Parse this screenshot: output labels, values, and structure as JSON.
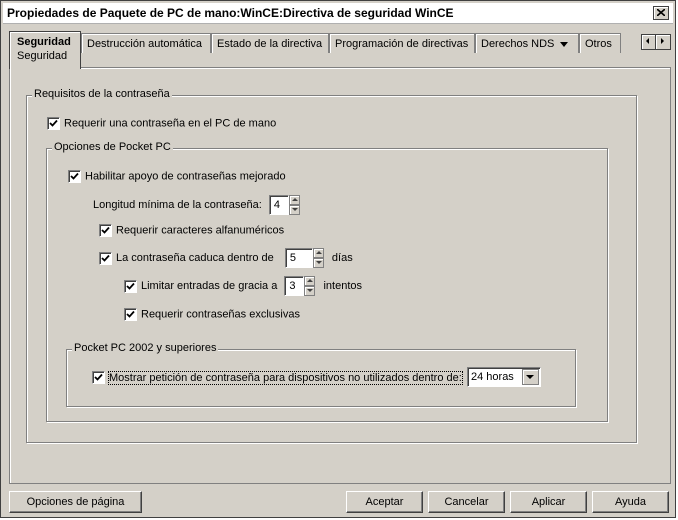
{
  "window": {
    "title": "Propiedades de Paquete de PC de mano:WinCE:Directiva de seguridad WinCE"
  },
  "tabs": [
    {
      "label": "Seguridad",
      "sublabel": "Seguridad"
    },
    {
      "label": "Destrucción automática"
    },
    {
      "label": "Estado de la directiva"
    },
    {
      "label": "Programación de directivas"
    },
    {
      "label": "Derechos NDS"
    },
    {
      "label": "Otros"
    }
  ],
  "password_group": {
    "title": "Requisitos de la contraseña",
    "require_password": {
      "label": "Requerir una contraseña en el PC de mano",
      "checked": true
    }
  },
  "pocketpc_group": {
    "title": "Opciones de Pocket PC",
    "enhanced_support": {
      "label": "Habilitar apoyo de contraseñas mejorado",
      "checked": true
    },
    "min_length": {
      "label": "Longitud mínima de la contraseña:",
      "value": "4"
    },
    "alphanumeric": {
      "label": "Requerir caracteres alfanuméricos",
      "checked": true
    },
    "expires": {
      "label": "La contraseña caduca dentro de",
      "value": "5",
      "unit": "días",
      "checked": true
    },
    "grace": {
      "label": "Limitar entradas de gracia a",
      "value": "3",
      "unit": "intentos",
      "checked": true
    },
    "exclusive": {
      "label": "Requerir contraseñas exclusivas",
      "checked": true
    }
  },
  "pocketpc2002_group": {
    "title": "Pocket PC 2002 y superiores",
    "prompt_idle": {
      "label": "Mostrar petición de contraseña para dispositivos no utilizados dentro de:",
      "checked": true,
      "selected": "24 horas"
    }
  },
  "buttons": {
    "page_options": "Opciones de página",
    "ok": "Aceptar",
    "cancel": "Cancelar",
    "apply": "Aplicar",
    "help": "Ayuda"
  }
}
